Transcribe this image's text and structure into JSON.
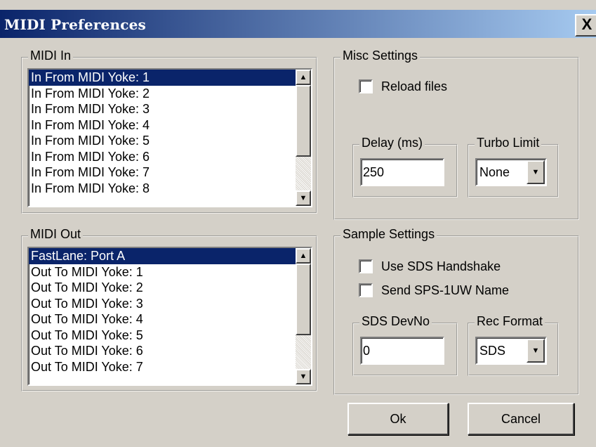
{
  "window": {
    "title": "MIDI Preferences",
    "close_glyph": "X"
  },
  "midi_in": {
    "label": "MIDI In",
    "items": [
      "In From MIDI Yoke:  1",
      "In From MIDI Yoke:  2",
      "In From MIDI Yoke:  3",
      "In From MIDI Yoke:  4",
      "In From MIDI Yoke:  5",
      "In From MIDI Yoke:  6",
      "In From MIDI Yoke:  7",
      "In From MIDI Yoke:  8"
    ],
    "selected_index": 0
  },
  "midi_out": {
    "label": "MIDI Out",
    "items": [
      "FastLane: Port A",
      "Out To MIDI Yoke:  1",
      "Out To MIDI Yoke:  2",
      "Out To MIDI Yoke:  3",
      "Out To MIDI Yoke:  4",
      "Out To MIDI Yoke:  5",
      "Out To MIDI Yoke:  6",
      "Out To MIDI Yoke:  7"
    ],
    "selected_index": 0
  },
  "misc": {
    "label": "Misc Settings",
    "reload_files": {
      "label": "Reload files",
      "checked": false
    },
    "delay": {
      "label": "Delay (ms)",
      "value": "250"
    },
    "turbo_limit": {
      "label": "Turbo Limit",
      "selected": "None"
    }
  },
  "sample": {
    "label": "Sample Settings",
    "use_sds_handshake": {
      "label": "Use SDS Handshake",
      "checked": false
    },
    "send_name": {
      "label": "Send SPS-1UW Name",
      "checked": false
    },
    "sds_devno": {
      "label": "SDS DevNo",
      "value": "0"
    },
    "rec_format": {
      "label": "Rec Format",
      "selected": "SDS"
    }
  },
  "buttons": {
    "ok": "Ok",
    "cancel": "Cancel"
  },
  "icons": {
    "scroll_up": "scroll-up-arrow-icon",
    "scroll_down": "scroll-down-arrow-icon",
    "dropdown": "dropdown-arrow-icon"
  },
  "colors": {
    "dialog_face": "#d4d0c8",
    "title_start": "#0a246a",
    "title_end": "#a6caf0",
    "selection": "#0a246a"
  }
}
